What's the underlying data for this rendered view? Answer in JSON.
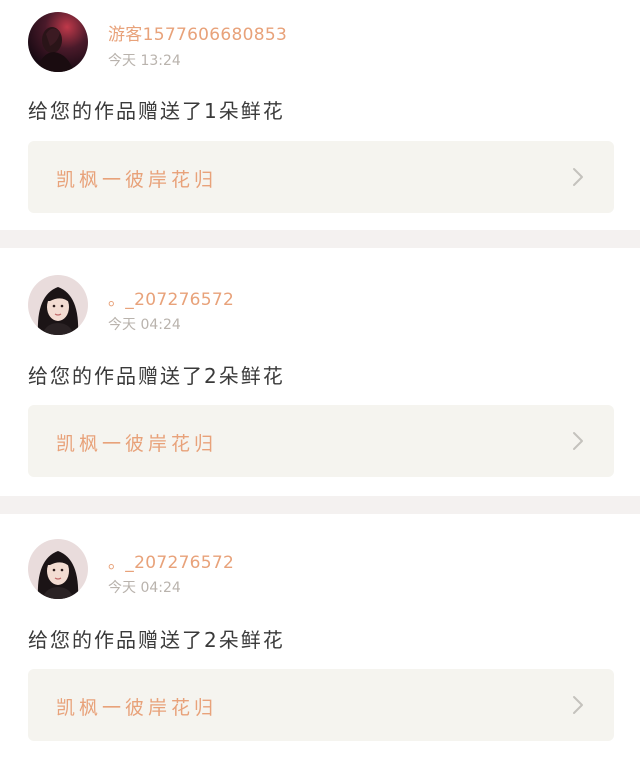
{
  "notifications": [
    {
      "username": "游客1577606680853",
      "time": "今天 13:24",
      "message": "给您的作品赠送了1朵鲜花",
      "work_title": "凯枫一彼岸花归",
      "avatar": "dark-portrait-avatar",
      "chevron_icon": "chevron-right-icon"
    },
    {
      "username": "。_207276572",
      "time": "今天 04:24",
      "message": "给您的作品赠送了2朵鲜花",
      "work_title": "凯枫一彼岸花归",
      "avatar": "girl-portrait-avatar",
      "chevron_icon": "chevron-right-icon"
    },
    {
      "username": "。_207276572",
      "time": "今天 04:24",
      "message": "给您的作品赠送了2朵鲜花",
      "work_title": "凯枫一彼岸花归",
      "avatar": "girl-portrait-avatar",
      "chevron_icon": "chevron-right-icon"
    }
  ],
  "colors": {
    "accent": "#e8a27a",
    "muted_text": "#b9b3ad",
    "body_text": "#3a3a3a",
    "card_background": "#f5f4ef",
    "separator": "#f4f1f0"
  }
}
